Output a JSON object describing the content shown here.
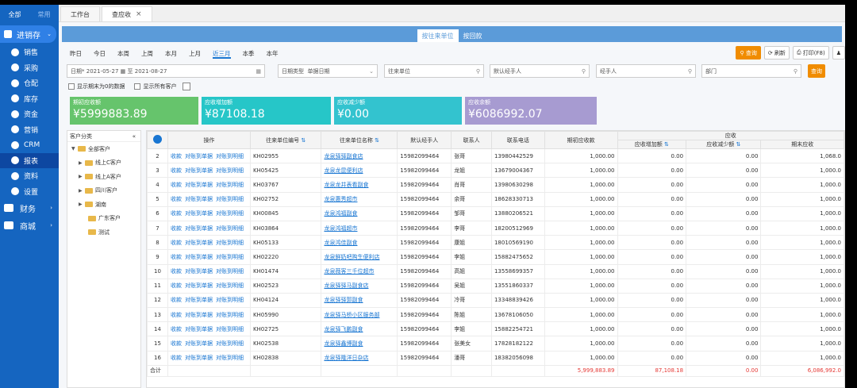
{
  "sidebar": {
    "tab_all": "全部",
    "tab_common": "常用",
    "section": "进销存",
    "items": [
      "销售",
      "采购",
      "仓配",
      "库存",
      "资金",
      "营销",
      "CRM",
      "报表",
      "资料",
      "设置"
    ],
    "groups": [
      "财务",
      "商城"
    ]
  },
  "tabs": [
    "工作台",
    "查应收"
  ],
  "subtabs": [
    "按往来单位",
    "按回款"
  ],
  "periods": [
    "昨日",
    "今日",
    "本周",
    "上周",
    "本月",
    "上月",
    "近三月",
    "本季",
    "本年"
  ],
  "buttons": {
    "query": "查询",
    "refresh": "刷新",
    "print": "打印(F8)",
    "search": "查询"
  },
  "filters": {
    "date_label": "日期",
    "date_from": "2021-05-27",
    "to": "至",
    "date_to": "2021-08-27",
    "date_type_label": "日期类型",
    "date_type": "单据日期",
    "partner": "往来单位",
    "default_handler": "默认经手人",
    "handler": "经手人",
    "dept": "部门"
  },
  "checks": [
    "显示期末为0的数据",
    "显示所有客户"
  ],
  "cards": [
    {
      "label": "期初应收额",
      "value": "¥5999883.89",
      "color": "#66c46c"
    },
    {
      "label": "应收增加额",
      "value": "¥87108.18",
      "color": "#26c6c8"
    },
    {
      "label": "应收减少额",
      "value": "¥0.00",
      "color": "#33c3cf"
    },
    {
      "label": "应收余额",
      "value": "¥6086992.07",
      "color": "#a79bd1"
    }
  ],
  "tree": {
    "title": "客户分类",
    "collapse": "«",
    "nodes": [
      "全部客户",
      "线上C客户",
      "线上A客户",
      "四川客户",
      "湖南",
      "广东客户",
      "测试"
    ]
  },
  "table": {
    "headers": [
      "操作",
      "往来单位编号",
      "往来单位名称",
      "默认经手人",
      "联系人",
      "联系电话",
      "期初应收款",
      "应收",
      "应收增加额",
      "应收减少额",
      "期末应收"
    ],
    "actions": [
      "收款",
      "对账到单据",
      "对账到明细"
    ],
    "rows": [
      [
        "2",
        "KH02955",
        "龙泉驿驿副食店",
        "15982099464",
        "张哥",
        "13980442529",
        "1,000.00",
        "0.00",
        "0.00",
        "1,068.0"
      ],
      [
        "3",
        "KH05425",
        "龙泉龙昆便利店",
        "15982099464",
        "龙姐",
        "13679004367",
        "1,000.00",
        "0.00",
        "0.00",
        "1,000.0"
      ],
      [
        "4",
        "KH03767",
        "龙泉龙井表看副食",
        "15982099464",
        "肖哥",
        "13980630298",
        "1,000.00",
        "0.00",
        "0.00",
        "1,000.0"
      ],
      [
        "5",
        "KH02752",
        "龙泉惠秀超市",
        "15982099464",
        "余哥",
        "18628330713",
        "1,000.00",
        "0.00",
        "0.00",
        "1,000.0"
      ],
      [
        "6",
        "KH00845",
        "龙泉鸿福副食",
        "15982099464",
        "邹哥",
        "13880206521",
        "1,000.00",
        "0.00",
        "0.00",
        "1,000.0"
      ],
      [
        "7",
        "KH03864",
        "龙泉鸿福超市",
        "15982099464",
        "李哥",
        "18200512969",
        "1,000.00",
        "0.00",
        "0.00",
        "1,000.0"
      ],
      [
        "8",
        "KH05133",
        "龙泉鸿佳副食",
        "15982099464",
        "康姐",
        "18010569190",
        "1,000.00",
        "0.00",
        "0.00",
        "1,000.0"
      ],
      [
        "9",
        "KH02220",
        "龙泉鲜奶吧购生便利店",
        "15982099464",
        "李姐",
        "15882475652",
        "1,000.00",
        "0.00",
        "0.00",
        "1,000.0"
      ],
      [
        "10",
        "KH01474",
        "龙泉薇客三千位超市",
        "15982099464",
        "高姐",
        "13558699357",
        "1,000.00",
        "0.00",
        "0.00",
        "1,000.0"
      ],
      [
        "11",
        "KH02523",
        "龙泉驿驿马副食店",
        "15982099464",
        "吴姐",
        "13551860337",
        "1,000.00",
        "0.00",
        "0.00",
        "1,000.0"
      ],
      [
        "12",
        "KH04124",
        "龙泉驿驿郭副食",
        "15982099464",
        "冷哥",
        "13348839426",
        "1,000.00",
        "0.00",
        "0.00",
        "1,000.0"
      ],
      [
        "13",
        "KH05990",
        "龙泉驿马桥小区服务部",
        "15982099464",
        "陈姐",
        "13678106050",
        "1,000.00",
        "0.00",
        "0.00",
        "1,000.0"
      ],
      [
        "14",
        "KH02725",
        "龙泉驿飞鹏副食",
        "15982099464",
        "李姐",
        "15882254721",
        "1,000.00",
        "0.00",
        "0.00",
        "1,000.0"
      ],
      [
        "15",
        "KH02538",
        "龙泉驿鑫博副食",
        "15982099464",
        "张美女",
        "17828182122",
        "1,000.00",
        "0.00",
        "0.00",
        "1,000.0"
      ],
      [
        "16",
        "KH02838",
        "龙泉驿隆洋日杂店",
        "15982099464",
        "潘哥",
        "18382056098",
        "1,000.00",
        "0.00",
        "0.00",
        "1,000.0"
      ]
    ],
    "sum_label": "合计",
    "sum": [
      "5,999,883.89",
      "87,108.18",
      "0.00",
      "6,086,992.0"
    ]
  }
}
